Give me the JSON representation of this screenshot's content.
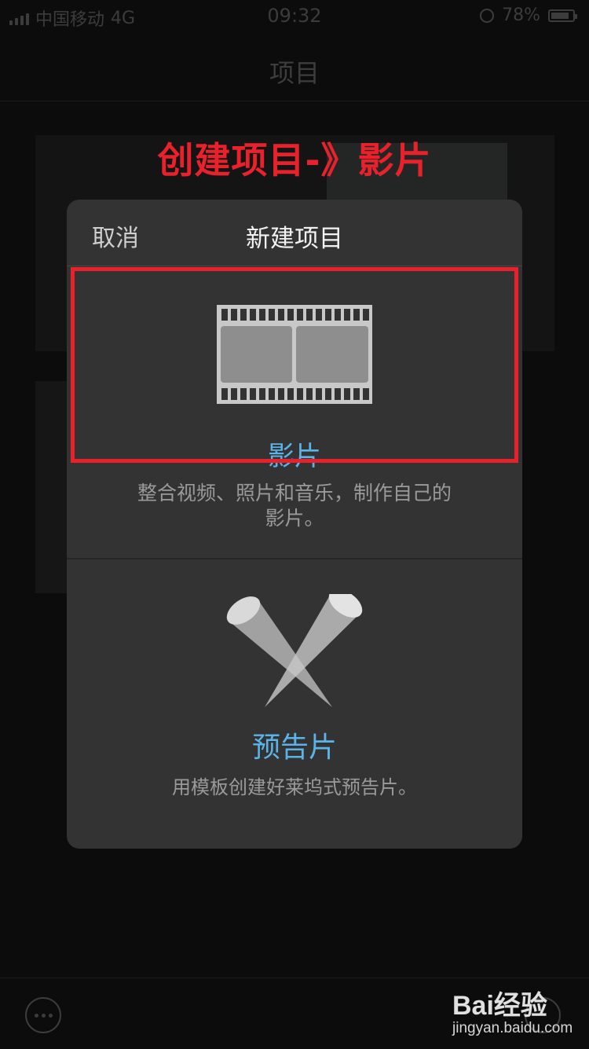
{
  "status_bar": {
    "carrier": "中国移动",
    "network": "4G",
    "time": "09:32",
    "battery": "78%"
  },
  "nav": {
    "title": "项目"
  },
  "annotation": {
    "text": "创建项目-》影片",
    "color": "#e8212b"
  },
  "dialog": {
    "cancel_label": "取消",
    "title": "新建项目",
    "movie": {
      "icon": "film-strip-icon",
      "label": "影片",
      "description": "整合视频、照片和音乐，制作自己的影片。"
    },
    "trailer": {
      "icon": "spotlight-icon",
      "label": "预告片",
      "description": "用模板创建好莱坞式预告片。"
    }
  },
  "bottom_bar": {
    "more_icon": "ellipsis-icon",
    "add_icon": "plus-circle-icon"
  },
  "watermark": {
    "logo": "Bai经验",
    "url": "jingyan.baidu.com"
  },
  "colors": {
    "accent_blue": "#5ab4ea",
    "highlight_red": "#e8212b",
    "dialog_bg": "#333333"
  }
}
